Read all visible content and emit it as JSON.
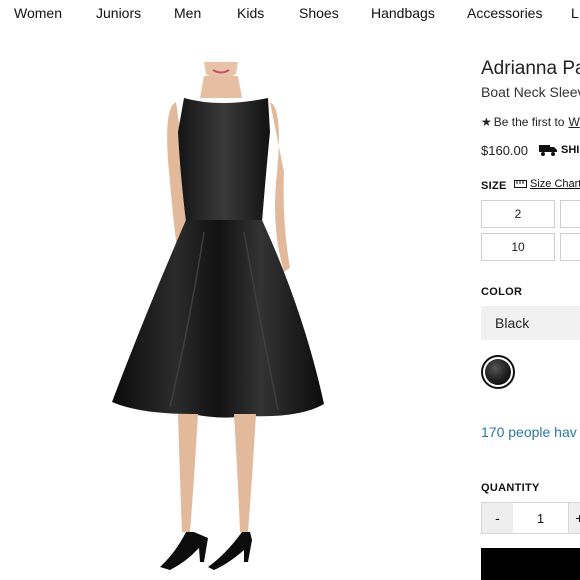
{
  "nav": {
    "items": [
      "Women",
      "Juniors",
      "Men",
      "Kids",
      "Shoes",
      "Handbags",
      "Accessories",
      "L"
    ]
  },
  "product": {
    "title": "Adrianna Pa",
    "subtitle": "Boat Neck Sleev",
    "review_text": "Be the first to",
    "review_link": "W",
    "price": "$160.00",
    "shipping": "SHI",
    "size_label": "SIZE",
    "size_chart": "Size Chart",
    "sizes": [
      "2",
      "",
      "10",
      ""
    ],
    "color_label": "COLOR",
    "selected_color": "Black",
    "swatch_color": "#111111",
    "viewers": "170 people hav",
    "quantity_label": "QUANTITY",
    "qty_minus": "-",
    "quantity": "1",
    "qty_plus": "+"
  },
  "icons": {
    "star": "star-icon",
    "truck": "truck-icon",
    "ruler": "ruler-icon"
  }
}
